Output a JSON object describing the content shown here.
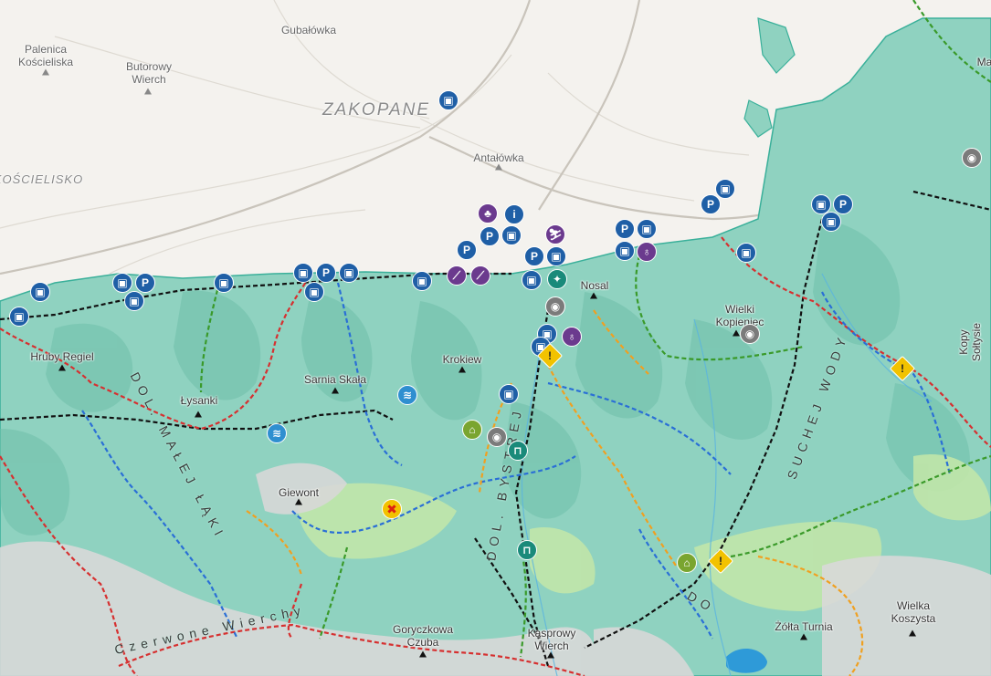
{
  "map": {
    "labels": {
      "palenica": "Palenica\nKościeliska",
      "gubalowka": "Gubałówka",
      "butorowy": "Butorowy\nWierch",
      "zakopane": "ZAKOPANE",
      "antalowka": "Antałówka",
      "koscielisko": "KOŚCIELISKO",
      "hruby_regiel": "Hruby Regiel",
      "lysanki": "Łysanki",
      "sarnia_skala": "Sarnia Skała",
      "krokiew": "Krokiew",
      "nosal": "Nosal",
      "wielki_kopieniec": "Wielki\nKopieniec",
      "kopy_soltysie": "Kopy\nSołtysie",
      "giewont": "Giewont",
      "goryczkowa": "Goryczkowa\nCzuba",
      "kasprowy": "Kasprowy\nWierch",
      "zolta_turnia": "Żółta Turnia",
      "wielka_koszysta": "Wielka\nKoszysta",
      "dol_malej_laki": "DOL. MAŁEJ ŁĄKI",
      "czerwone_wierchy": "Czerwone Wierchy",
      "dol_bystrej": "DOL. BYSTREJ",
      "suchej_wody": "SUCHEJ WODY",
      "dol_edge": "DO",
      "ma_edge": "Ma"
    },
    "icons": [
      {
        "id": "parking",
        "label": "P"
      },
      {
        "id": "bus",
        "label": "▣"
      },
      {
        "id": "info",
        "label": "i"
      },
      {
        "id": "warning",
        "label": "!"
      },
      {
        "id": "shelter",
        "label": "⌂"
      },
      {
        "id": "closed",
        "label": "✖"
      }
    ],
    "colors": {
      "forest": "#8fd2c0",
      "forest_dark": "#6fbfaa",
      "meadow": "#c4e7a8",
      "rock": "#d8d8d8",
      "urban": "#f0ede7",
      "trail_red": "#d63030",
      "trail_blue": "#2a6fd6",
      "trail_green": "#3a9a2a",
      "trail_yellow": "#f0a020",
      "trail_black": "#111111",
      "park_border": "#3ab09a",
      "lake": "#2e9ad8"
    }
  }
}
